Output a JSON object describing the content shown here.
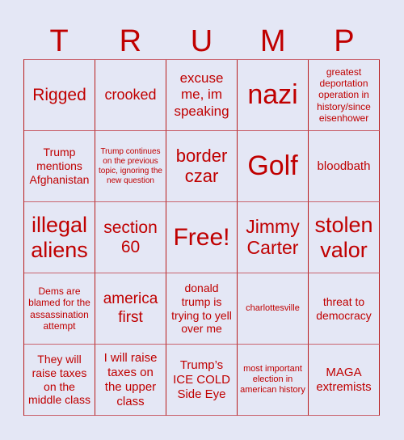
{
  "card": {
    "title_letters": [
      "T",
      "R",
      "U",
      "M",
      "P"
    ],
    "colors": {
      "background": "#e4e7f5",
      "text": "#c00000",
      "grid_line": "#b81c1c"
    },
    "rows": [
      [
        "Rigged",
        "crooked",
        "excuse me, im speaking",
        "nazi",
        "greatest deportation operation in history/since eisenhower"
      ],
      [
        "Trump mentions Afghanistan",
        "Trump continues on the previous topic, ignoring the new question",
        "border czar",
        "Golf",
        "bloodbath"
      ],
      [
        "illegal aliens",
        "section 60",
        "Free!",
        "Jimmy Carter",
        "stolen valor"
      ],
      [
        "Dems are blamed for the assassination attempt",
        "america first",
        "donald trump is trying to yell over me",
        "charlottesville",
        "threat to democracy"
      ],
      [
        "They will raise taxes on the middle class",
        "I will raise taxes on the upper class",
        "Trump’s ICE COLD Side Eye",
        "most important election in american history",
        "MAGA extremists"
      ]
    ]
  }
}
